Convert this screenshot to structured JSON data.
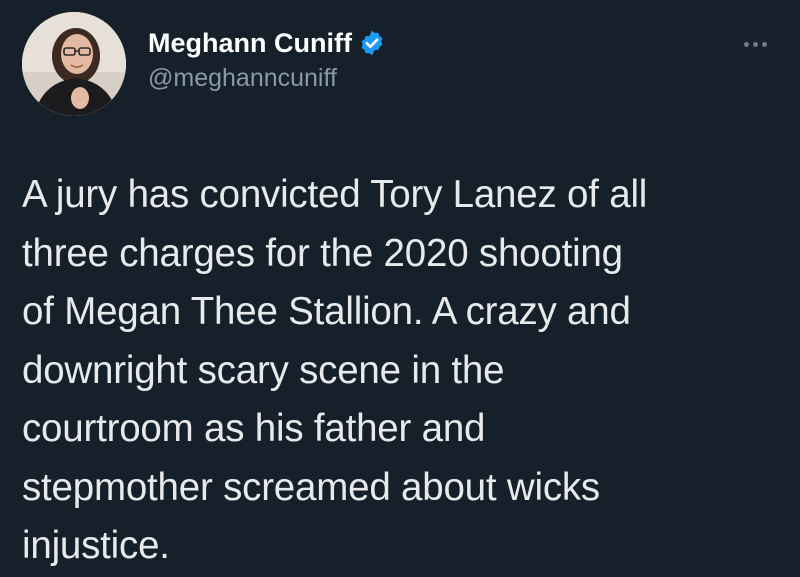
{
  "author": {
    "display_name": "Meghann Cuniff",
    "handle": "@meghanncuniff",
    "verified": true,
    "avatar": "profile-photo"
  },
  "menu": {
    "icon": "more-options-icon"
  },
  "tweet": {
    "text": "A jury has convicted Tory Lanez of all\nthree charges for the 2020 shooting\nof Megan Thee Stallion. A crazy and\ndownright scary scene in the\ncourtroom as his father and\nstepmother screamed about wicks\ninjustice."
  },
  "colors": {
    "background": "#15202b",
    "text_primary": "#e7e9ea",
    "text_secondary": "#8b98a5",
    "verified_badge": "#1d9bf0"
  }
}
